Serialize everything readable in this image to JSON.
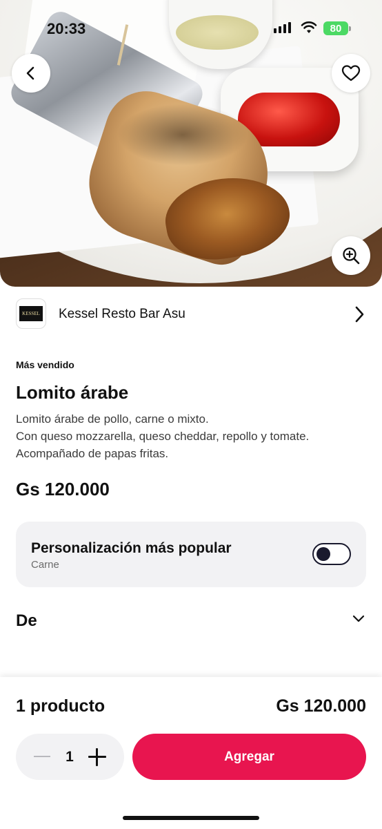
{
  "status_bar": {
    "time": "20:33",
    "battery": "80"
  },
  "hero": {
    "photo": "lomito-arabe-photo",
    "back_icon": "chevron-left-icon",
    "favorite_icon": "heart-icon",
    "zoom_icon": "zoom-in-icon"
  },
  "store": {
    "name": "Kessel Resto Bar Asu",
    "logo_text": "KESSEL"
  },
  "product": {
    "badge": "Más vendido",
    "title": "Lomito árabe",
    "description_lines": [
      "Lomito árabe de pollo, carne o mixto.",
      "Con queso mozzarella, queso cheddar, repollo y tomate.",
      "Acompañado de papas fritas."
    ],
    "price": "Gs 120.000"
  },
  "customization": {
    "title": "Personalización más popular",
    "subtitle": "Carne",
    "toggle_on": false
  },
  "section": {
    "label": "De"
  },
  "footer": {
    "count_label": "1 producto",
    "total": "Gs 120.000",
    "quantity": "1",
    "add_label": "Agregar"
  },
  "colors": {
    "accent": "#e8154f",
    "card_bg": "#f2f2f4"
  }
}
